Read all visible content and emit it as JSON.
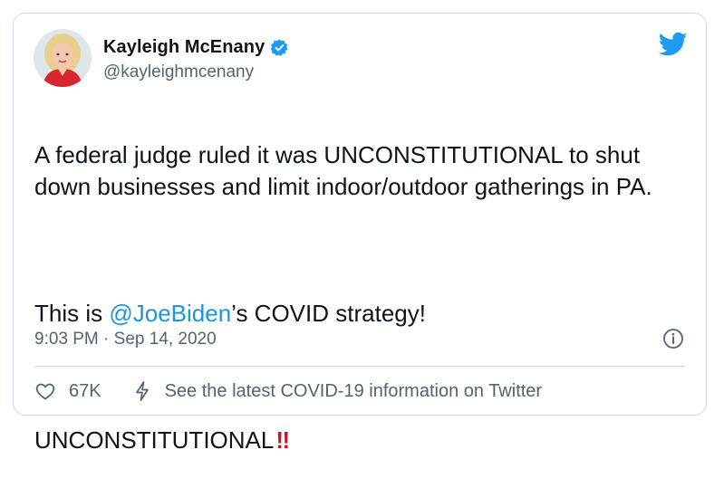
{
  "author": {
    "display_name": "Kayleigh McEnany",
    "handle": "@kayleighmcenany",
    "verified": true
  },
  "tweet": {
    "line1": "A federal judge ruled it was UNCONSTITUTIONAL to shut down businesses and limit indoor/outdoor gatherings in PA.",
    "line2_prefix": "This is ",
    "line2_mention": "@JoeBiden",
    "line2_suffix": "’s COVID strategy!",
    "line3": "UNCONSTITUTIONAL",
    "line3_emoji": "‼"
  },
  "timestamp": "9:03 PM · Sep 14, 2020",
  "footer": {
    "like_count": "67K",
    "covid_link": "See the latest COVID-19 information on Twitter"
  },
  "icons": {
    "verified": "verified-badge-icon",
    "brand": "twitter-bird-icon",
    "info": "info-icon",
    "like": "heart-icon",
    "covid": "lightning-icon"
  },
  "colors": {
    "brand_blue": "#1d9bf0",
    "mention_blue": "#1b95e0",
    "text_primary": "#0f1419",
    "text_secondary": "#536471",
    "border": "#cfd9de",
    "emoji_red": "#be1931"
  }
}
